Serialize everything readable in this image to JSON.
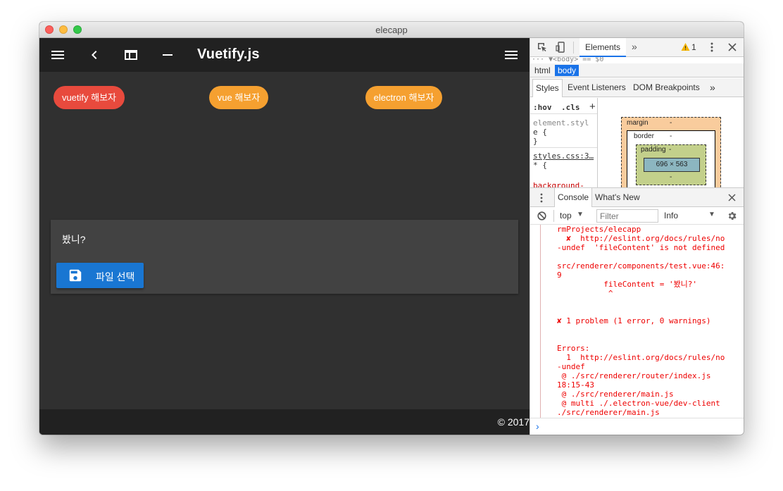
{
  "window": {
    "title": "elecapp"
  },
  "app": {
    "toolbar": {
      "icons": [
        "menu-icon",
        "back-icon",
        "web-icon",
        "remove-icon",
        "menu-icon"
      ],
      "title": "Vuetify.js"
    },
    "chips": [
      {
        "label": "vuetify 해보자",
        "color": "#e84a3d"
      },
      {
        "label": "vue 해보자",
        "color": "#f5a030"
      },
      {
        "label": "electron 해보자",
        "color": "#f5a030"
      }
    ],
    "card": {
      "text": "봤니?",
      "button_label": "파일 선택",
      "button_icon": "save-icon",
      "button_color": "#1976d2"
    },
    "footer": {
      "text": "© 2017"
    }
  },
  "devtools": {
    "toolbar": {
      "tab": "Elements",
      "more": "»",
      "warning_count": "1",
      "warning_icon": "warning-icon"
    },
    "dom_crumb": "··· ▼<body> == $0",
    "breadcrumbs": [
      "html",
      "body"
    ],
    "sub_tabs": [
      "Styles",
      "Event Listeners",
      "DOM Breakpoints",
      "»"
    ],
    "styles": {
      "hov": ":hov",
      "cls": ".cls",
      "add": "+",
      "lines": [
        "element.styl",
        "e {",
        "}",
        "styles.css:3…",
        "* {",
        "background-"
      ]
    },
    "box_model": {
      "margin_label": "margin",
      "border_label": "border",
      "padding_label": "padding",
      "dash": "-",
      "content_size": "696 × 563"
    },
    "drawer_tabs": [
      "Console",
      "What's New"
    ],
    "console_bar": {
      "context": "top",
      "filter_placeholder": "Filter",
      "level": "Info"
    },
    "console_lines": [
      "rmProjects/elecapp",
      "  ✘  http://eslint.org/docs/rules/no",
      "-undef  'fileContent' is not defined",
      "",
      "src/renderer/components/test.vue:46:",
      "9",
      "          fileContent = '봤니?'",
      "           ^",
      "",
      "",
      "✘ 1 problem (1 error, 0 warnings)",
      "",
      "",
      "Errors:",
      "  1  http://eslint.org/docs/rules/no",
      "-undef",
      " @ ./src/renderer/router/index.js",
      "18:15-43",
      " @ ./src/renderer/main.js",
      " @ multi ./.electron-vue/dev-client",
      "./src/renderer/main.js"
    ],
    "prompt": "›"
  }
}
